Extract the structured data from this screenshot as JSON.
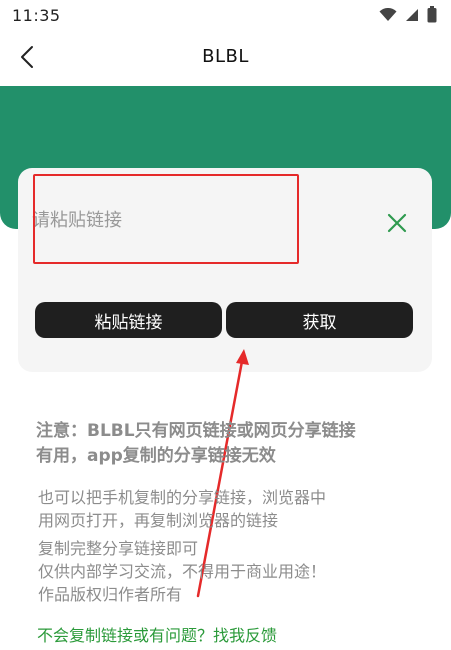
{
  "status_bar": {
    "time": "11:35",
    "icons": [
      "wifi-icon",
      "signal-icon",
      "battery-icon"
    ]
  },
  "app_bar": {
    "back_icon": "back-chevron-icon",
    "title": "BLBL"
  },
  "colors": {
    "header_green": "#22906a",
    "button_dark": "#1f1f1f",
    "clear_icon_green": "#2f9a4f",
    "annotation_red": "#e52a2a",
    "link_green": "#2b9a3a",
    "note_gray": "#8c8c8c"
  },
  "form": {
    "input_placeholder": "请粘贴链接",
    "input_value": "",
    "clear_icon": "clear-x-icon",
    "paste_button": "粘贴链接",
    "fetch_button": "获取"
  },
  "notes": {
    "strong_line1": "注意：BLBL只有网页链接或网页分享链接",
    "strong_line2": "有用，app复制的分享链接无效",
    "p1_line1": "也可以把手机复制的分享链接，浏览器中",
    "p1_line2": "用网页打开，再复制浏览器的链接",
    "p2_line1": "复制完整分享链接即可",
    "p2_line2": "仅供内部学习交流，不得用于商业用途！",
    "p2_line3": "作品版权归作者所有"
  },
  "help_link": "不会复制链接或有问题？找我反馈"
}
